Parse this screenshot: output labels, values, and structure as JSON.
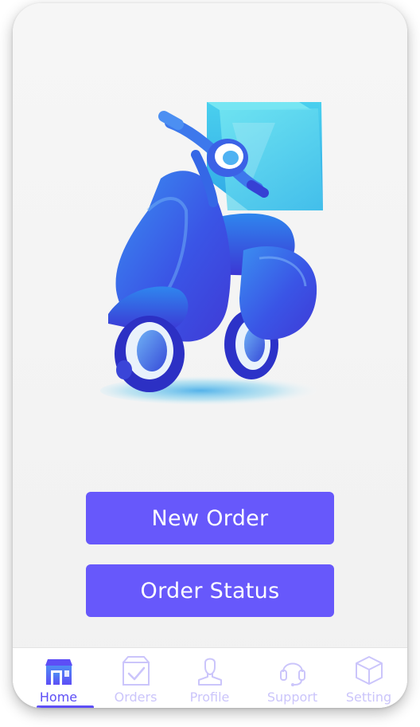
{
  "colors": {
    "accent": "#6758fb",
    "tab_active": "#5d4ef6",
    "tab_inactive": "#cbc5fb",
    "background": "#f4f4f4"
  },
  "hero": {
    "icon": "delivery-scooter-illustration"
  },
  "actions": {
    "new_order_label": "New Order",
    "order_status_label": "Order Status"
  },
  "tabbar": {
    "active": "home",
    "items": [
      {
        "id": "home",
        "label": "Home",
        "icon": "store-icon"
      },
      {
        "id": "orders",
        "label": "Orders",
        "icon": "box-check-icon"
      },
      {
        "id": "profile",
        "label": "Profile",
        "icon": "person-icon"
      },
      {
        "id": "support",
        "label": "Support",
        "icon": "headset-icon"
      },
      {
        "id": "setting",
        "label": "Setting",
        "icon": "cube-icon"
      }
    ]
  }
}
